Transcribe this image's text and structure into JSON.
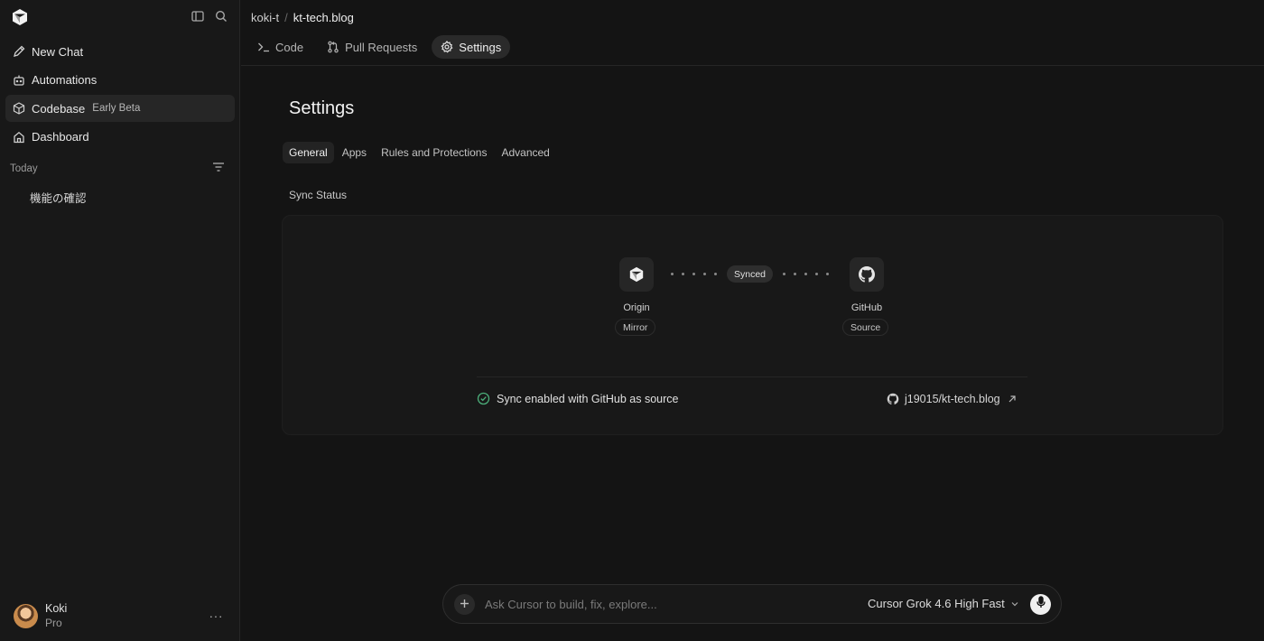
{
  "sidebar": {
    "items": [
      {
        "label": "New Chat",
        "icon": "pen-icon"
      },
      {
        "label": "Automations",
        "icon": "robot-icon"
      },
      {
        "label": "Codebase",
        "icon": "cube-icon",
        "badge": "Early Beta",
        "active": true
      },
      {
        "label": "Dashboard",
        "icon": "home-icon"
      }
    ],
    "section_title": "Today",
    "chats": [
      "機能の確認"
    ],
    "user": {
      "name": "Koki",
      "plan": "Pro",
      "more": "···"
    }
  },
  "breadcrumb": {
    "owner": "koki-t",
    "separator": "/",
    "repo": "kt-tech.blog"
  },
  "repo_tabs": [
    {
      "label": "Code",
      "icon": "terminal-icon"
    },
    {
      "label": "Pull Requests",
      "icon": "pull-request-icon"
    },
    {
      "label": "Settings",
      "icon": "gear-icon",
      "active": true
    }
  ],
  "settings": {
    "title": "Settings",
    "tabs": [
      {
        "label": "General",
        "active": true
      },
      {
        "label": "Apps"
      },
      {
        "label": "Rules and Protections"
      },
      {
        "label": "Advanced"
      }
    ],
    "sync_status_label": "Sync Status",
    "sync": {
      "origin": {
        "name": "Origin",
        "role": "Mirror",
        "icon": "cursor-logo-icon"
      },
      "state": "Synced",
      "github": {
        "name": "GitHub",
        "role": "Source",
        "icon": "github-icon"
      },
      "message": "Sync enabled with GitHub as source",
      "repo_link": "j19015/kt-tech.blog"
    }
  },
  "composer": {
    "placeholder": "Ask Cursor to build, fix, explore...",
    "model": "Cursor Grok 4.6 High Fast"
  },
  "colors": {
    "background": "#141414",
    "sidebar": "#181818",
    "success": "#4caf7a"
  }
}
